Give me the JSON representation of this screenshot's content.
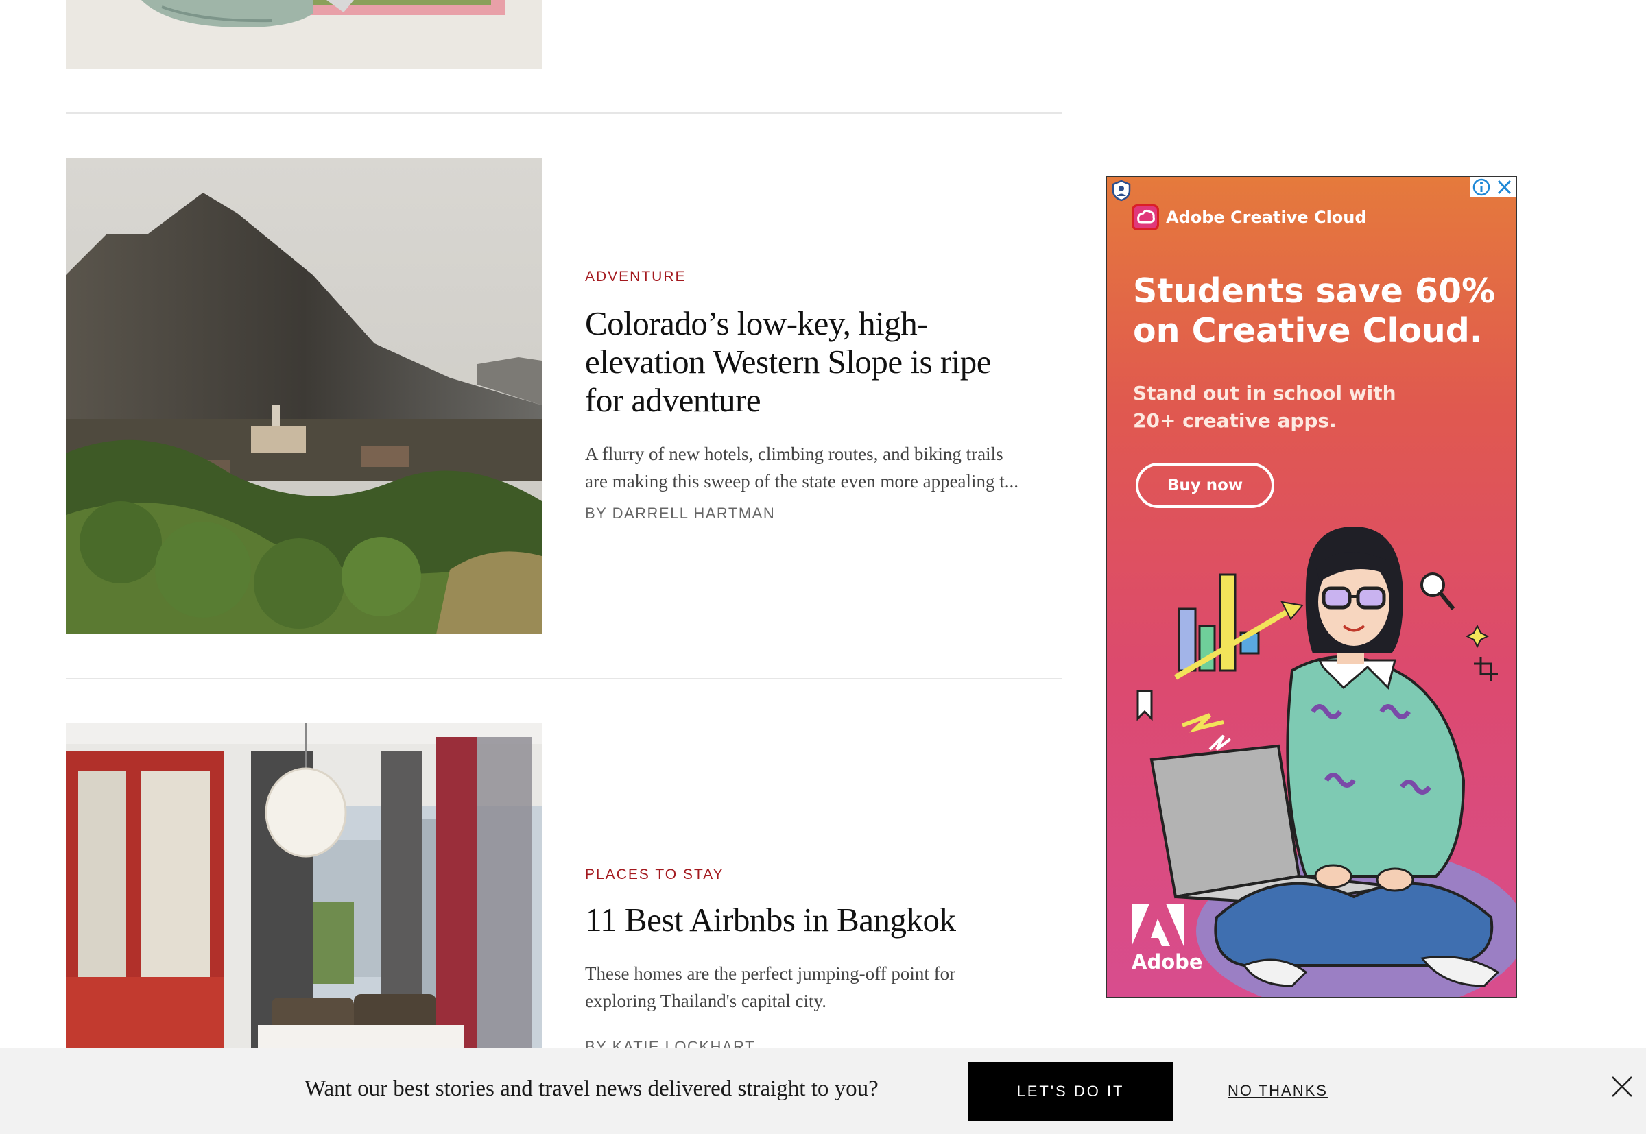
{
  "articles": [
    {
      "kicker": "ADVENTURE",
      "headline_lines": [
        "Colorado’s low-key, high-",
        "elevation Western Slope is ripe",
        "for adventure"
      ],
      "dek_lines": [
        "A flurry of new hotels, climbing routes, and biking trails",
        "are making this sweep of the state even more appealing t..."
      ],
      "byline": "BY DARRELL HARTMAN",
      "image_icon": "mountain-town-photo"
    },
    {
      "kicker": "PLACES TO STAY",
      "headline_lines": [
        "11 Best Airbnbs in Bangkok"
      ],
      "dek_lines": [
        "These homes are the perfect jumping-off point for",
        "exploring Thailand's capital city."
      ],
      "byline": "BY KATIE LOCKHART",
      "image_icon": "bedroom-interior-photo"
    }
  ],
  "ad": {
    "brand": "Adobe Creative Cloud",
    "headline_lines": [
      "Students save 60%",
      "on Creative Cloud."
    ],
    "subtext_lines": [
      "Stand out in school with",
      "20+ creative apps."
    ],
    "button": "Buy now",
    "logo_text": "Adobe",
    "info_icon": "info-icon",
    "close_icon": "close-icon"
  },
  "newsletter": {
    "prompt": "Want our best stories and travel news delivered straight to you?",
    "cta": "LET'S DO IT",
    "decline": "NO THANKS"
  },
  "colors": {
    "kicker": "#a3191e",
    "ad_top": "#e57a3c",
    "ad_bottom": "#d84d8e",
    "cta_bg": "#000000"
  }
}
